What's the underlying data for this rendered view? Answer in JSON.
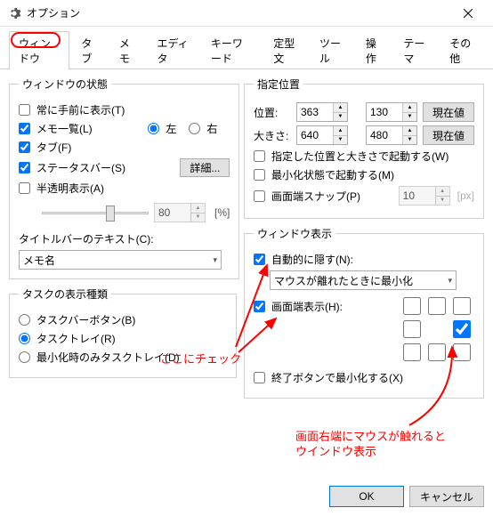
{
  "window": {
    "title": "オプション"
  },
  "tabs": {
    "items": [
      "ウィンドウ",
      "タブ",
      "メモ",
      "エディタ",
      "キーワード",
      "定型文",
      "ツール",
      "操作",
      "テーマ",
      "その他"
    ],
    "active_index": 0
  },
  "state_group": {
    "legend": "ウィンドウの状態",
    "always_top": "常に手前に表示(T)",
    "memo_list": "メモ一覧(L)",
    "side_left": "左",
    "side_right": "右",
    "tab": "タブ(F)",
    "statusbar": "ステータスバー(S)",
    "details_btn": "詳細...",
    "translucent": "半透明表示(A)",
    "opacity_value": "80",
    "opacity_unit": "[%]",
    "titlebar_label": "タイトルバーのテキスト(C):",
    "titlebar_select": "メモ名"
  },
  "taskbar_group": {
    "legend": "タスクの表示種類",
    "taskbar_btn": "タスクバーボタン(B)",
    "tasktray": "タスクトレイ(R)",
    "minimize_only": "最小化時のみタスクトレイ(D)"
  },
  "position_group": {
    "legend": "指定位置",
    "pos_label": "位置:",
    "pos_x": "363",
    "pos_y": "130",
    "size_label": "大きさ:",
    "size_w": "640",
    "size_h": "480",
    "current_btn": "現在値",
    "launch_pos": "指定した位置と大きさで起動する(W)",
    "launch_min": "最小化状態で起動する(M)",
    "snap": "画面端スナップ(P)",
    "snap_px": "10",
    "snap_unit": "[px]"
  },
  "display_group": {
    "legend": "ウィンドウ表示",
    "auto_hide": "自動的に隠す(N):",
    "auto_hide_select": "マウスが離れたときに最小化",
    "edge_display": "画面端表示(H):",
    "exit_minimize": "終了ボタンで最小化する(X)"
  },
  "buttons": {
    "ok": "OK",
    "cancel": "キャンセル"
  },
  "annotations": {
    "check_here": "ここにチェック",
    "right_edge1": "画面右端にマウスが触れると",
    "right_edge2": "ウインドウ表示"
  }
}
